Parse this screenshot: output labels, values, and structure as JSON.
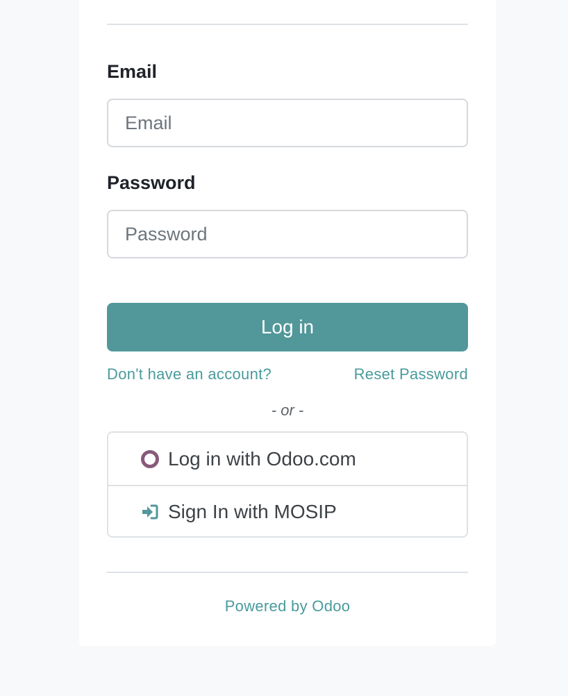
{
  "form": {
    "email_label": "Email",
    "email_placeholder": "Email",
    "email_value": "",
    "password_label": "Password",
    "password_placeholder": "Password",
    "password_value": "",
    "login_button_label": "Log in"
  },
  "links": {
    "signup_label": "Don't have an account?",
    "reset_password_label": "Reset Password"
  },
  "separator_text": "- or -",
  "oauth": {
    "providers": [
      {
        "label": "Log in with Odoo.com",
        "icon": "odoo-circle-icon"
      },
      {
        "label": "Sign In with MOSIP",
        "icon": "sign-in-arrow-icon"
      }
    ]
  },
  "footer": {
    "powered_by": "Powered by Odoo"
  },
  "colors": {
    "primary": "#52979a",
    "link": "#4a9a9c",
    "odoo_purple": "#875a7b",
    "page_background": "#f8f9fb",
    "card_background": "#ffffff"
  }
}
